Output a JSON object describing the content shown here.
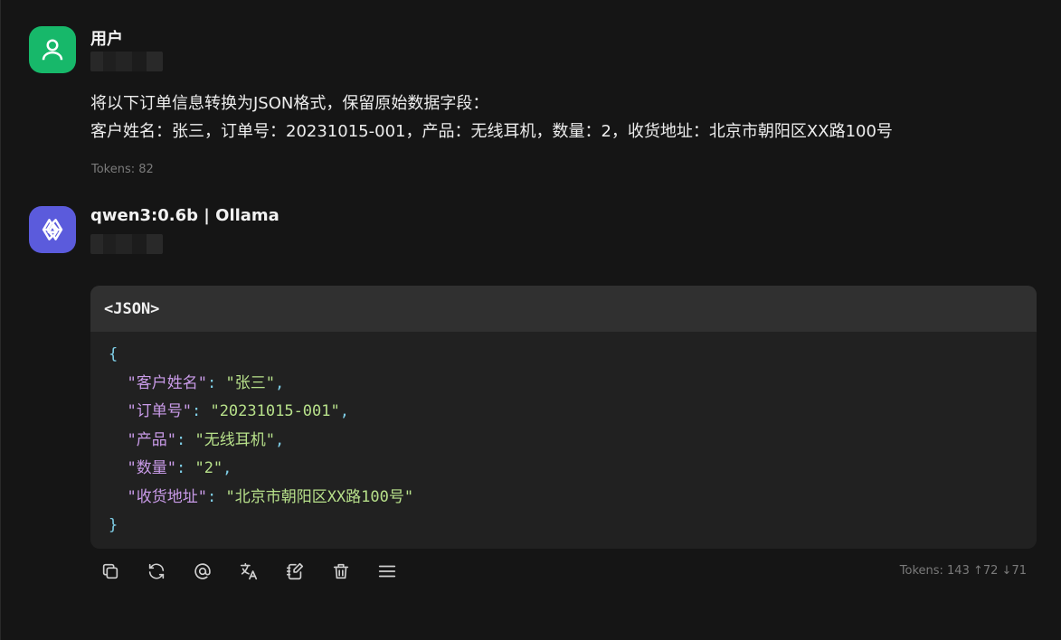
{
  "user_message": {
    "sender": "用户",
    "lines": [
      "将以下订单信息转换为JSON格式，保留原始数据字段：",
      "客户姓名：张三，订单号：20231015-001，产品：无线耳机，数量：2，收货地址：北京市朝阳区XX路100号"
    ],
    "tokens": "Tokens: 82"
  },
  "assistant_message": {
    "sender": "qwen3:0.6b | Ollama",
    "code_block": {
      "language_label": "<JSON>",
      "open_brace": "{",
      "close_brace": "}",
      "entries": [
        {
          "key": "\"客户姓名\"",
          "value": "\"张三\"",
          "trail": ","
        },
        {
          "key": "\"订单号\"",
          "value": "\"20231015-001\"",
          "trail": ","
        },
        {
          "key": "\"产品\"",
          "value": "\"无线耳机\"",
          "trail": ","
        },
        {
          "key": "\"数量\"",
          "value": "\"2\"",
          "trail": ","
        },
        {
          "key": "\"收货地址\"",
          "value": "\"北京市朝阳区XX路100号\"",
          "trail": ""
        }
      ]
    },
    "tokens": "Tokens: 143 ↑72 ↓71",
    "actions": [
      "copy-icon",
      "regenerate-icon",
      "mention-icon",
      "translate-icon",
      "edit-icon",
      "delete-icon",
      "menu-icon"
    ]
  },
  "colors": {
    "background": "#151515",
    "user_avatar": "#17b86a",
    "bot_avatar": "#5b5bdc",
    "json_key": "#c99be8",
    "json_value": "#b7e08a",
    "json_punct": "#7fcfe8"
  }
}
